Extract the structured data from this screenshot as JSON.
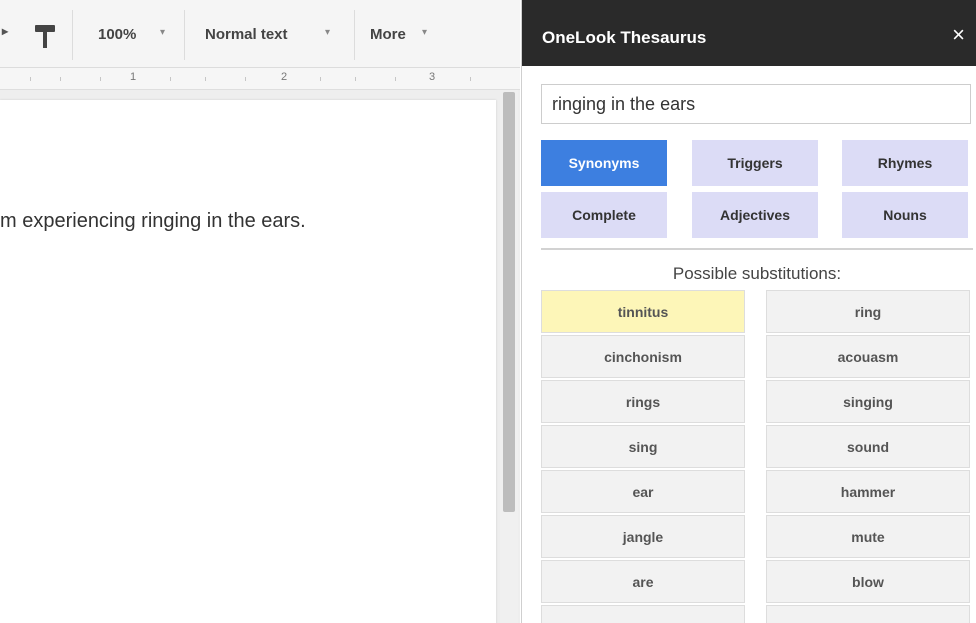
{
  "toolbar": {
    "zoom": "100%",
    "style": "Normal text",
    "more": "More",
    "caret": "▾"
  },
  "ruler": {
    "marks": [
      "1",
      "2",
      "3"
    ]
  },
  "document": {
    "text": "m experiencing ringing in the ears."
  },
  "sidebar": {
    "title": "OneLook Thesaurus",
    "close": "×",
    "search_value": "ringing in the ears",
    "modes": [
      {
        "label": "Synonyms",
        "active": true
      },
      {
        "label": "Triggers",
        "active": false
      },
      {
        "label": "Rhymes",
        "active": false
      },
      {
        "label": "Complete",
        "active": false
      },
      {
        "label": "Adjectives",
        "active": false
      },
      {
        "label": "Nouns",
        "active": false
      }
    ],
    "substitutions_label": "Possible substitutions:",
    "left_words": [
      "tinnitus",
      "cinchonism",
      "rings",
      "sing",
      "ear",
      "jangle",
      "are",
      "..."
    ],
    "right_words": [
      "ring",
      "acouasm",
      "singing",
      "sound",
      "hammer",
      "mute",
      "blow",
      "..."
    ]
  },
  "colors": {
    "accent": "#3d7fe0",
    "mode_bg": "#dcdcf6",
    "highlight": "#fdf6b8",
    "header_bg": "#2a2a2a"
  }
}
